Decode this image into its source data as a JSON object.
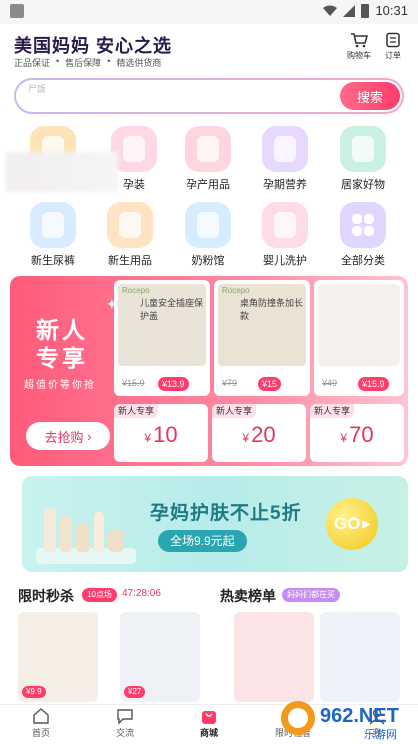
{
  "status_bar": {
    "time": "10:31"
  },
  "header": {
    "brand_title": "美国妈妈  安心之选",
    "taglines": [
      "正品保证",
      "售后保障",
      "精选供货商"
    ],
    "cart_label": "购物车",
    "orders_label": "订单"
  },
  "search": {
    "placeholder": "尸饭",
    "button_label": "搜索"
  },
  "categories": [
    {
      "label": "",
      "color": "#ffe3b8"
    },
    {
      "label": "孕装",
      "color": "#ffd8e8"
    },
    {
      "label": "孕产用品",
      "color": "#ffd6df"
    },
    {
      "label": "孕期营养",
      "color": "#e6d8ff"
    },
    {
      "label": "居家好物",
      "color": "#c9f0e0"
    },
    {
      "label": "新生尿裤",
      "color": "#d9ecff"
    },
    {
      "label": "新生用品",
      "color": "#ffe3c2"
    },
    {
      "label": "奶粉馆",
      "color": "#d6ecff"
    },
    {
      "label": "婴儿洗护",
      "color": "#ffdbe6"
    },
    {
      "label": "全部分类",
      "color": "#e0d6ff"
    }
  ],
  "promo": {
    "title": "新人专享",
    "subtitle": "超值价等你抢",
    "button_label": "去抢购",
    "products": [
      {
        "tag": "Rocepo",
        "caption": "儿童安全插座保护盖",
        "old_price": "¥15.9",
        "new_price": "¥13.9"
      },
      {
        "tag": "Rocepo",
        "caption": "桌角防撞条加长款",
        "old_price": "¥79",
        "new_price": "¥15"
      },
      {
        "tag": "",
        "caption": "",
        "old_price": "¥49",
        "new_price": "¥15.9"
      }
    ],
    "coupons": [
      {
        "label": "新人专享",
        "currency": "¥",
        "amount": "10"
      },
      {
        "label": "新人专享",
        "currency": "¥",
        "amount": "20"
      },
      {
        "label": "新人专享",
        "currency": "¥",
        "amount": "70"
      }
    ]
  },
  "banner": {
    "title": "孕妈护肤不止5折",
    "pill": "全场9.9元起",
    "go_label": "GO"
  },
  "flash_sale": {
    "title": "限时秒杀",
    "tag": "10点场",
    "countdown": "47:28:06",
    "products": [
      {
        "price": "¥9.9"
      },
      {
        "price": "¥27"
      }
    ]
  },
  "hot_list": {
    "title": "热卖榜单",
    "tag": "妈妈们都在买"
  },
  "tabs": [
    {
      "label": "首页",
      "active": false
    },
    {
      "label": "交流",
      "active": false
    },
    {
      "label": "商城",
      "active": true
    },
    {
      "label": "限时福音",
      "active": false
    },
    {
      "label": "我",
      "active": false
    }
  ],
  "watermark": {
    "text": "962.NET",
    "sub": "乐游网"
  },
  "colors": {
    "accent": "#ff3c6a",
    "brand_text": "#2a1a4a",
    "teal": "#2aa6b0"
  }
}
